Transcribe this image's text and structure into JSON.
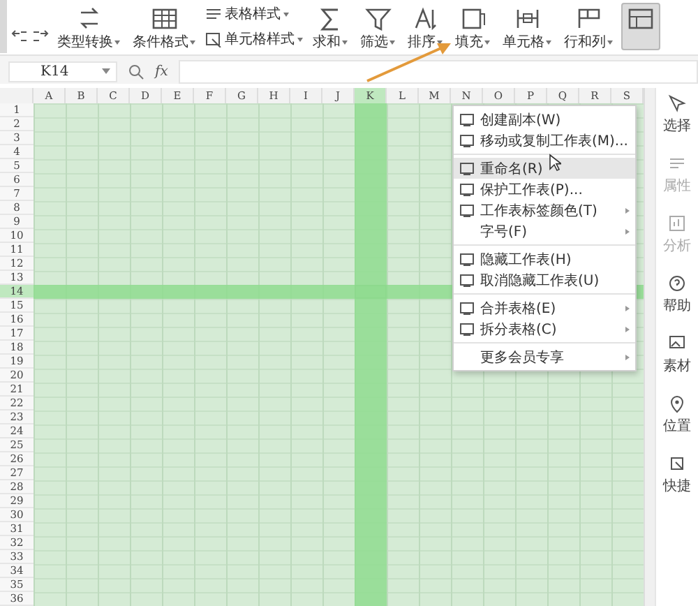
{
  "toolbar": [
    {
      "kind": "decimal"
    },
    {
      "kind": "large",
      "label": "类型转换",
      "dropdown": true
    },
    {
      "kind": "large",
      "label": "条件格式",
      "dropdown": true
    },
    {
      "kind": "stack",
      "items": [
        {
          "label": "表格样式",
          "dropdown": true
        },
        {
          "label": "单元格样式",
          "dropdown": true
        }
      ]
    },
    {
      "kind": "large",
      "label": "求和",
      "dropdown": true
    },
    {
      "kind": "large",
      "label": "筛选",
      "dropdown": true
    },
    {
      "kind": "large",
      "label": "排序",
      "dropdown": true
    },
    {
      "kind": "large",
      "label": "填充",
      "dropdown": true
    },
    {
      "kind": "large",
      "label": "单元格",
      "dropdown": true
    },
    {
      "kind": "large",
      "label": "行和列",
      "dropdown": true
    },
    {
      "kind": "icon",
      "pressed": true
    }
  ],
  "formula_bar": {
    "name_box": "K14",
    "function_button": "fx"
  },
  "sheet": {
    "columns": [
      {
        "label": "A",
        "selected": false
      },
      {
        "label": "B",
        "selected": false
      },
      {
        "label": "C",
        "selected": false
      },
      {
        "label": "D",
        "selected": false
      },
      {
        "label": "E",
        "selected": false
      },
      {
        "label": "F",
        "selected": false
      },
      {
        "label": "G",
        "selected": false
      },
      {
        "label": "H",
        "selected": false
      },
      {
        "label": "I",
        "selected": false
      },
      {
        "label": "J",
        "selected": false
      },
      {
        "label": "K",
        "selected": true
      },
      {
        "label": "L",
        "selected": false
      },
      {
        "label": "M",
        "selected": false
      },
      {
        "label": "N",
        "selected": false
      },
      {
        "label": "O",
        "selected": false
      },
      {
        "label": "P",
        "selected": false
      },
      {
        "label": "Q",
        "selected": false
      },
      {
        "label": "R",
        "selected": false
      },
      {
        "label": "S",
        "selected": false
      }
    ],
    "rows": [
      {
        "label": "1",
        "selected": false
      },
      {
        "label": "2",
        "selected": false
      },
      {
        "label": "3",
        "selected": false
      },
      {
        "label": "4",
        "selected": false
      },
      {
        "label": "5",
        "selected": false
      },
      {
        "label": "6",
        "selected": false
      },
      {
        "label": "7",
        "selected": false
      },
      {
        "label": "8",
        "selected": false
      },
      {
        "label": "9",
        "selected": false
      },
      {
        "label": "10",
        "selected": false
      },
      {
        "label": "11",
        "selected": false
      },
      {
        "label": "12",
        "selected": false
      },
      {
        "label": "13",
        "selected": false
      },
      {
        "label": "14",
        "selected": true
      },
      {
        "label": "15",
        "selected": false
      },
      {
        "label": "16",
        "selected": false
      },
      {
        "label": "17",
        "selected": false
      },
      {
        "label": "18",
        "selected": false
      },
      {
        "label": "19",
        "selected": false
      },
      {
        "label": "20",
        "selected": false
      },
      {
        "label": "21",
        "selected": false
      },
      {
        "label": "22",
        "selected": false
      },
      {
        "label": "23",
        "selected": false
      },
      {
        "label": "24",
        "selected": false
      },
      {
        "label": "25",
        "selected": false
      },
      {
        "label": "26",
        "selected": false
      },
      {
        "label": "27",
        "selected": false
      },
      {
        "label": "28",
        "selected": false
      },
      {
        "label": "29",
        "selected": false
      },
      {
        "label": "30",
        "selected": false
      },
      {
        "label": "31",
        "selected": false
      },
      {
        "label": "32",
        "selected": false
      },
      {
        "label": "33",
        "selected": false
      },
      {
        "label": "34",
        "selected": false
      },
      {
        "label": "35",
        "selected": false
      },
      {
        "label": "36",
        "selected": false
      }
    ]
  },
  "context_menu": {
    "groups": [
      [
        {
          "label": "创建副本(W)",
          "icon": true,
          "submenu": false,
          "selected": false
        },
        {
          "label": "移动或复制工作表(M)...",
          "icon": true,
          "submenu": false,
          "selected": false
        }
      ],
      [
        {
          "label": "重命名(R)",
          "icon": true,
          "submenu": false,
          "selected": true
        },
        {
          "label": "保护工作表(P)...",
          "icon": true,
          "submenu": false,
          "selected": false
        },
        {
          "label": "工作表标签颜色(T)",
          "icon": true,
          "submenu": true,
          "selected": false
        },
        {
          "label": "字号(F)",
          "icon": false,
          "submenu": true,
          "selected": false
        }
      ],
      [
        {
          "label": "隐藏工作表(H)",
          "icon": true,
          "submenu": false,
          "selected": false
        },
        {
          "label": "取消隐藏工作表(U)",
          "icon": true,
          "submenu": false,
          "selected": false
        }
      ],
      [
        {
          "label": "合并表格(E)",
          "icon": true,
          "submenu": true,
          "selected": false
        },
        {
          "label": "拆分表格(C)",
          "icon": true,
          "submenu": true,
          "selected": false
        }
      ],
      [
        {
          "label": "更多会员专享",
          "icon": false,
          "submenu": true,
          "selected": false
        }
      ]
    ],
    "mouse_cursor": true
  },
  "sidebar": [
    {
      "label": "选择",
      "disabled": false
    },
    {
      "label": "属性",
      "disabled": true
    },
    {
      "label": "分析",
      "disabled": true
    },
    {
      "label": "帮助",
      "disabled": false
    },
    {
      "label": "素材",
      "disabled": false
    },
    {
      "label": "位置",
      "disabled": false
    },
    {
      "label": "快捷",
      "disabled": false
    }
  ],
  "annotation_arrow": true
}
